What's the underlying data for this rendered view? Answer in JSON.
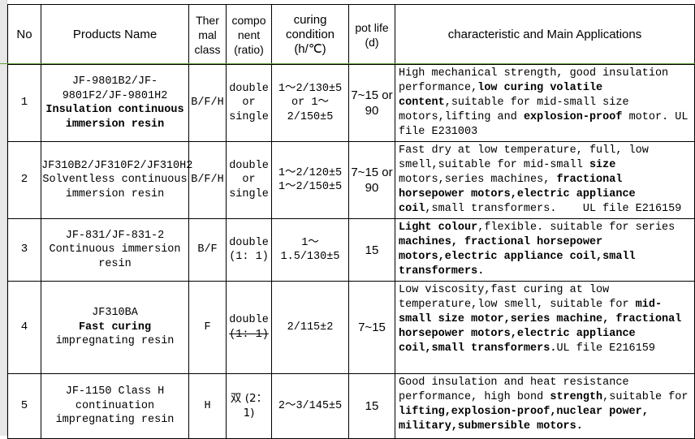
{
  "document": {
    "type": "spreadsheet-table",
    "title": "Insulating resin products specification table"
  },
  "header": {
    "no": "No",
    "products_name": "Products Name",
    "thermal_class": "Ther\nmal\nclass",
    "component": "compo\nnent\n(ratio)",
    "curing_condition": "curing\ncondition\n(h/℃)",
    "pot_life": "pot life\n(d)",
    "characteristic": "characteristic and Main Applications"
  },
  "rows": [
    {
      "no": "1",
      "name_plain": "JF-9801B2/JF-9801F2/JF-9801H2",
      "name_bold": "Insulation continuous immersion resin",
      "thermal_class": "B/F/H",
      "component": "double or single",
      "curing_condition": "1～2/130±5 or 1～2/150±5",
      "pot_life": "7~15 or 90",
      "characteristic": "High mechanical strength, good insulation performance, low curing volatile content, suitable for mid-small size motors, lifting and explosion-proof motor. UL file E231003"
    },
    {
      "no": "2",
      "name_plain": "JF310B2/JF310F2/JF310H2 Solventless continuous immersion resin",
      "name_bold": "",
      "thermal_class": "B/F/H",
      "component": "double or single",
      "curing_condition": "1～2/120±5 1～2/150±5",
      "pot_life": "7~15 or 90",
      "characteristic": "Fast dry at low temperature, full, low smell, suitable for mid-small size motors, series machines, fractional horsepower motors, electric appliance coil, small transformers.    UL file E216159"
    },
    {
      "no": "3",
      "name_plain": "JF-831/JF-831-2 Continuous immersion resin",
      "name_bold": "",
      "thermal_class": "B/F",
      "component": "double (1: 1)",
      "curing_condition": "1～1.5/130±5",
      "pot_life": "15",
      "characteristic": "Light colour, flexible. suitable for series machines, fractional horsepower motors, electric appliance coil, small transformers."
    },
    {
      "no": "4",
      "name_plain": "JF310BA",
      "name_bold": "Fast curing",
      "name_tail": "impregnating resin",
      "thermal_class": "F",
      "component": "double (1: 1)",
      "component_struck": "(1: 1)",
      "curing_condition": "2/115±2",
      "pot_life": "7~15",
      "characteristic": "Low viscosity, fast curing at low temperature, low smell, suitable for mid-small size motor, series machine, fractional horsepower motors, electric appliance coil, small transformers. UL file E216159"
    },
    {
      "no": "5",
      "name_plain": "JF-1150 Class H continuation impregnating resin",
      "name_bold": "",
      "thermal_class": "H",
      "component": "双 (2：1)",
      "curing_condition": "2～3/145±5",
      "pot_life": "15",
      "characteristic": "Good insulation and heat resistance performance, high bond strength, suitable for lifting, explosion-proof, nuclear power, military, submersible motors."
    }
  ],
  "colors": {
    "grid_line": "#000000",
    "sheet_gridline_green": "#5e9c3a",
    "gutter": "#e8e8e8",
    "text": "#000000"
  }
}
